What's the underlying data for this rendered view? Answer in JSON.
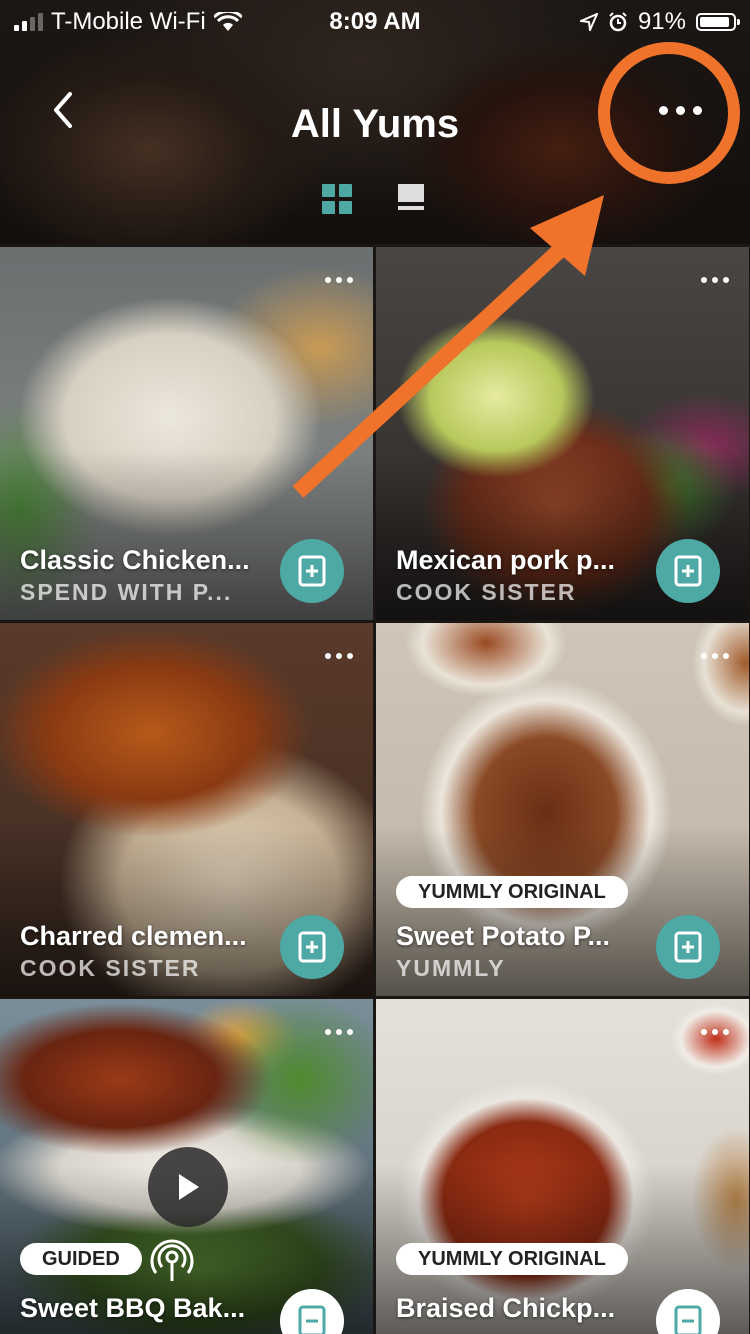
{
  "status_bar": {
    "carrier": "T-Mobile Wi-Fi",
    "time": "8:09 AM",
    "battery": "91%",
    "battery_level": 0.91
  },
  "header": {
    "title": "All Yums",
    "active_view": "grid",
    "accent_color": "#4ea8a3",
    "annotation_color": "#f0732c"
  },
  "recipes": [
    {
      "name": "Classic Chicken...",
      "source": "SPEND WITH P...",
      "badge": "",
      "guided": false
    },
    {
      "name": "Mexican pork p...",
      "source": "COOK SISTER",
      "badge": "",
      "guided": false
    },
    {
      "name": "Charred clemen...",
      "source": "COOK SISTER",
      "badge": "",
      "guided": false
    },
    {
      "name": "Sweet Potato P...",
      "source": "YUMMLY",
      "badge": "YUMMLY ORIGINAL",
      "guided": false
    },
    {
      "name": "Sweet BBQ Bak...",
      "source": "",
      "badge": "GUIDED",
      "guided": true
    },
    {
      "name": "Braised Chickp...",
      "source": "",
      "badge": "YUMMLY ORIGINAL",
      "guided": false
    }
  ]
}
